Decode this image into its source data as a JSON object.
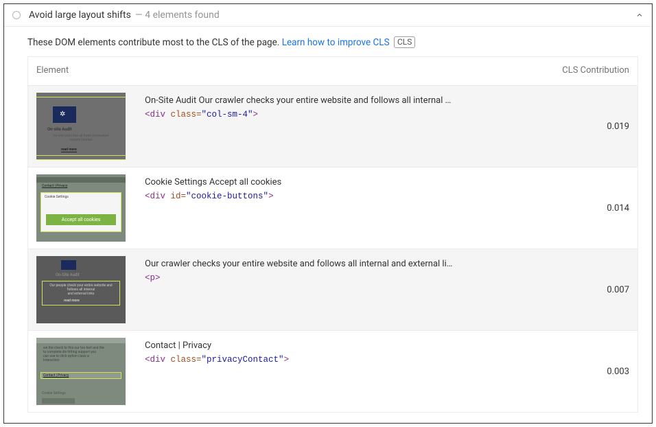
{
  "header": {
    "title": "Avoid large layout shifts",
    "subtitle": "— 4 elements found"
  },
  "description": {
    "text": "These DOM elements contribute most to the CLS of the page. ",
    "link": "Learn how to improve CLS",
    "badge": "CLS"
  },
  "columns": {
    "element": "Element",
    "contribution": "CLS Contribution"
  },
  "rows": [
    {
      "title": "On-Site Audit Our crawler checks your entire website and follows all internal …",
      "code_open": "<div ",
      "code_attr": "class=",
      "code_val": "\"col-sm-4\"",
      "code_close": ">",
      "score": "0.019"
    },
    {
      "title": "Cookie Settings Accept all cookies",
      "code_open": "<div ",
      "code_attr": "id=",
      "code_val": "\"cookie-buttons\"",
      "code_close": ">",
      "score": "0.014"
    },
    {
      "title": "Our crawler checks your entire website and follows all internal and external li…",
      "code_open": "<p>",
      "code_attr": "",
      "code_val": "",
      "code_close": "",
      "score": "0.007"
    },
    {
      "title": "Contact | Privacy",
      "code_open": "<div ",
      "code_attr": "class=",
      "code_val": "\"privacyContact\"",
      "code_close": ">",
      "score": "0.003"
    }
  ],
  "thumbs": {
    "t1_label": "On-site Audit",
    "t1_rm": "read more",
    "t2_label": "Cookie Settings",
    "t2_btn": "Accept all cookies",
    "t2_links": "Contact | Privacy",
    "t3_label": "On-Site Audit",
    "t3_rm": "read more",
    "t4_links": "Contact | Privacy",
    "t4_cs": "Cookie Settings"
  }
}
